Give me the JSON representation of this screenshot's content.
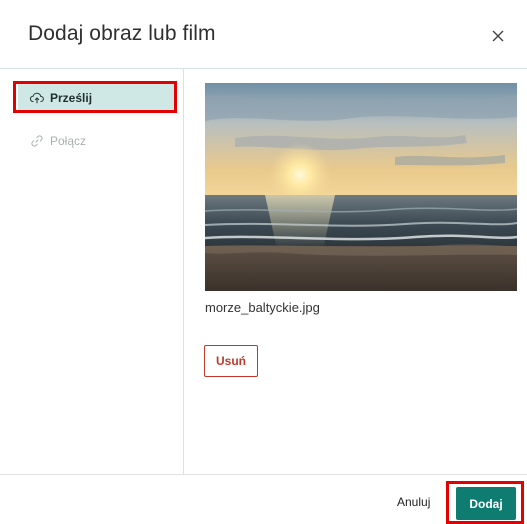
{
  "dialog": {
    "title": "Dodaj obraz lub film",
    "close_icon": "close-icon"
  },
  "sidebar": {
    "items": [
      {
        "label": "Prześlij",
        "icon": "cloud-upload-icon",
        "selected": true
      },
      {
        "label": "Połącz",
        "icon": "link-icon",
        "selected": false
      }
    ]
  },
  "preview": {
    "filename": "morze_baltyckie.jpg",
    "remove_label": "Usuń"
  },
  "footer": {
    "cancel_label": "Anuluj",
    "add_label": "Dodaj"
  },
  "colors": {
    "accent": "#0f7c72",
    "selected_bg": "#cfe8e5",
    "danger": "#c0392b",
    "highlight": "#e20000"
  }
}
